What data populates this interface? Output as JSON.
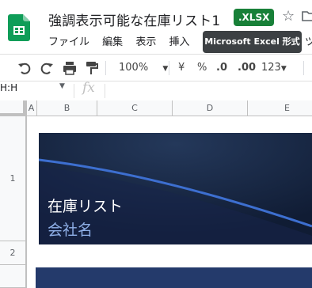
{
  "app": {
    "title": "強調表示可能な在庫リスト1",
    "badge": ".XLSX",
    "tooltip": "Microsoft Excel 形式"
  },
  "menu": {
    "items": [
      "ファイル",
      "編集",
      "表示",
      "挿入"
    ],
    "trailing": "ツ"
  },
  "toolbar": {
    "zoom": "100%",
    "currency": "¥",
    "percent": "%",
    "dec_decrease": ".0",
    "dec_increase": ".00",
    "format": "123"
  },
  "formula_bar": {
    "name_box": "H:H",
    "fx": "fx"
  },
  "grid": {
    "columns": [
      "A",
      "B",
      "C",
      "D",
      "E"
    ],
    "rows": [
      "1",
      "2"
    ]
  },
  "banner": {
    "title": "在庫リスト",
    "subtitle": "会社名"
  },
  "colors": {
    "badge_green": "#188038",
    "banner_navy": "#152544",
    "banner_subtitle": "#8fb0e8"
  }
}
